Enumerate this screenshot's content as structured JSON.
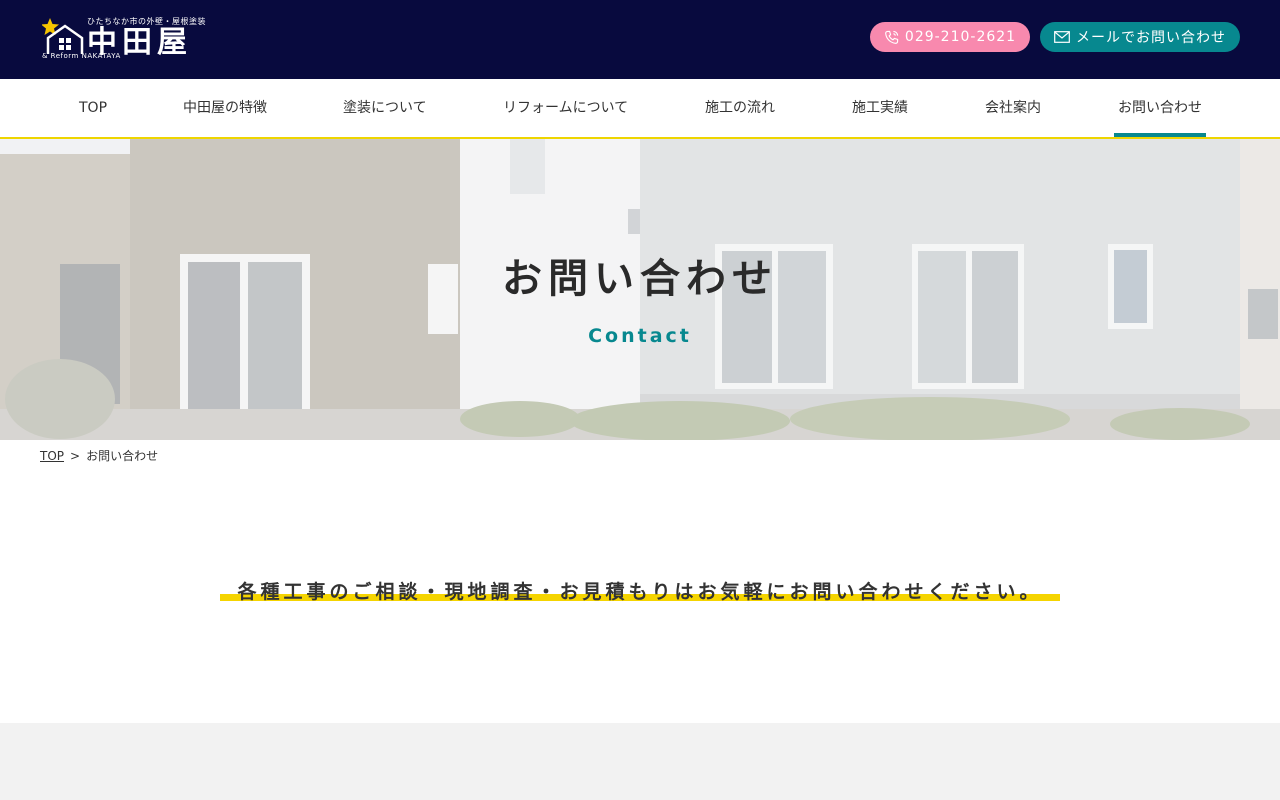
{
  "header": {
    "logo": {
      "tagline": "ひたちなか市の外壁・屋根塗装",
      "name": "中田屋",
      "sub": "& Reform NAKATAYA"
    },
    "tel_button": {
      "label": "029-210-2621",
      "icon": "phone-icon"
    },
    "mail_button": {
      "label": "メールでお問い合わせ",
      "icon": "mail-icon"
    },
    "colors": {
      "bar": "#080a3e",
      "tel": "#f889ae",
      "mail": "#07888f",
      "accent": "#eed500"
    }
  },
  "nav": {
    "items": [
      {
        "label": "TOP"
      },
      {
        "label": "中田屋の特徴"
      },
      {
        "label": "塗装について"
      },
      {
        "label": "リフォームについて"
      },
      {
        "label": "施工の流れ"
      },
      {
        "label": "施工実績"
      },
      {
        "label": "会社案内"
      },
      {
        "label": "お問い合わせ",
        "active": true
      }
    ]
  },
  "hero": {
    "title": "お問い合わせ",
    "subtitle": "Contact"
  },
  "breadcrumb": {
    "home": "TOP",
    "separator": ">",
    "current": "お問い合わせ"
  },
  "main": {
    "lead": "各種工事のご相談・現地調査・お見積もりはお気軽にお問い合わせください。"
  }
}
